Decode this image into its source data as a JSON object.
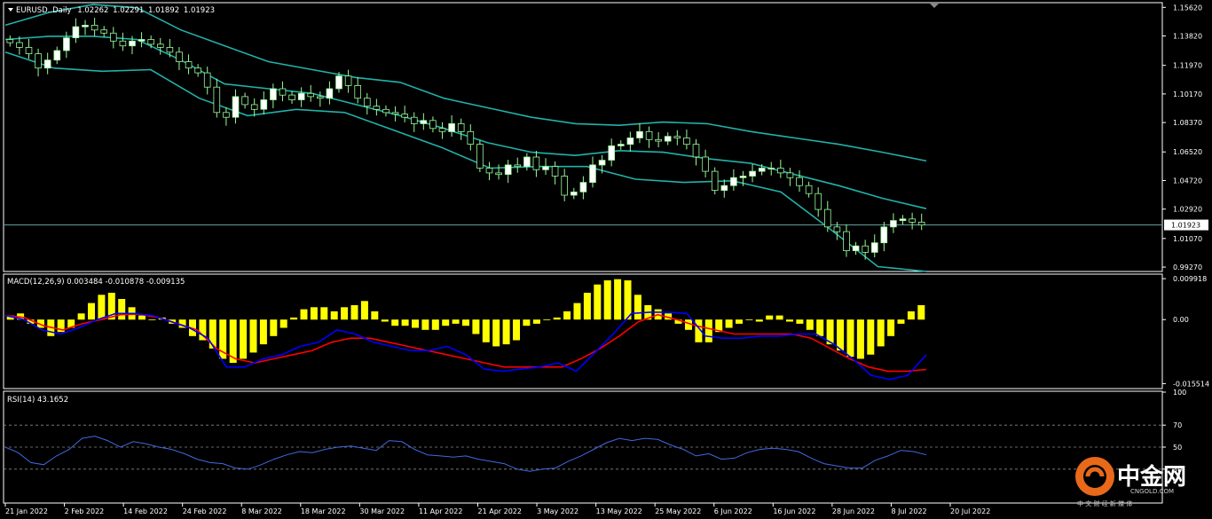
{
  "chart_data": [
    {
      "type": "candlestick",
      "panel": "price",
      "title": "EURUSD..Daily",
      "ohlc_header": [
        "1.02262",
        "1.02291",
        "1.01892",
        "1.01923"
      ],
      "current_price": 1.01923,
      "current_price_label": "1.01923",
      "ylim": [
        0.9905,
        1.1586
      ],
      "yticks": [
        1.1562,
        1.1382,
        1.1197,
        1.1017,
        1.0837,
        1.0652,
        1.0472,
        1.0292,
        1.0107,
        0.9927
      ],
      "ytick_labels": [
        "1.15620",
        "1.13820",
        "1.11970",
        "1.10170",
        "1.08370",
        "1.06520",
        "1.04720",
        "1.02920",
        "1.01070",
        "0.99270"
      ],
      "xlabels": [
        "21 Jan 2022",
        "2 Feb 2022",
        "14 Feb 2022",
        "24 Feb 2022",
        "8 Mar 2022",
        "18 Mar 2022",
        "30 Mar 2022",
        "11 Apr 2022",
        "21 Apr 2022",
        "3 May 2022",
        "13 May 2022",
        "25 May 2022",
        "6 Jun 2022",
        "16 Jun 2022",
        "28 Jun 2022",
        "8 Jul 2022",
        "20 Jul 2022"
      ],
      "close_series": [
        1.134,
        1.131,
        1.127,
        1.118,
        1.123,
        1.129,
        1.137,
        1.144,
        1.145,
        1.142,
        1.14,
        1.135,
        1.132,
        1.135,
        1.136,
        1.133,
        1.131,
        1.128,
        1.122,
        1.118,
        1.115,
        1.106,
        1.09,
        1.087,
        1.1,
        1.095,
        1.092,
        1.098,
        1.105,
        1.101,
        1.098,
        1.102,
        1.1,
        1.099,
        1.105,
        1.113,
        1.107,
        1.099,
        1.094,
        1.092,
        1.09,
        1.089,
        1.087,
        1.083,
        1.085,
        1.08,
        1.078,
        1.083,
        1.078,
        1.07,
        1.055,
        1.052,
        1.051,
        1.057,
        1.056,
        1.062,
        1.054,
        1.056,
        1.05,
        1.038,
        1.04,
        1.046,
        1.057,
        1.06,
        1.069,
        1.07,
        1.074,
        1.078,
        1.073,
        1.072,
        1.075,
        1.074,
        1.07,
        1.062,
        1.053,
        1.041,
        1.044,
        1.049,
        1.05,
        1.053,
        1.055,
        1.055,
        1.052,
        1.049,
        1.044,
        1.039,
        1.029,
        1.018,
        1.015,
        1.003,
        1.006,
        1.002,
        1.008,
        1.018,
        1.022,
        1.023,
        1.021,
        1.0192
      ],
      "bollinger": {
        "upper": [
          1.145,
          1.153,
          1.158,
          1.156,
          1.142,
          1.132,
          1.122,
          1.117,
          1.112,
          1.109,
          1.099,
          1.093,
          1.087,
          1.083,
          1.082,
          1.084,
          1.083,
          1.078,
          1.074,
          1.07,
          1.065,
          1.0595
        ],
        "middle": [
          1.136,
          1.138,
          1.138,
          1.136,
          1.123,
          1.108,
          1.105,
          1.102,
          1.095,
          1.088,
          1.08,
          1.071,
          1.065,
          1.063,
          1.066,
          1.065,
          1.061,
          1.058,
          1.051,
          1.044,
          1.036,
          1.0295
        ],
        "lower": [
          1.128,
          1.118,
          1.116,
          1.117,
          1.099,
          1.088,
          1.092,
          1.09,
          1.079,
          1.068,
          1.055,
          1.056,
          1.056,
          1.048,
          1.046,
          1.047,
          1.04,
          1.017,
          0.993,
          0.99
        ]
      }
    },
    {
      "type": "macd",
      "panel": "macd",
      "title": "MACD(12,26,9) 0.003484 -0.010878 -0.009135",
      "ylim": [
        -0.0165,
        0.0108
      ],
      "ytick_labels": [
        "0.009918",
        "0.00",
        "-0.015514"
      ],
      "yticks": [
        0.009918,
        0.0,
        -0.015514
      ],
      "histogram": [
        0.001,
        0.0015,
        -0.001,
        -0.002,
        -0.004,
        -0.003,
        -0.002,
        0.0015,
        0.004,
        0.006,
        0.0065,
        0.005,
        0.003,
        0.001,
        0.0,
        0.0005,
        -0.001,
        -0.002,
        -0.004,
        -0.005,
        -0.007,
        -0.0095,
        -0.0105,
        -0.0095,
        -0.008,
        -0.006,
        -0.004,
        -0.002,
        0.0005,
        0.0025,
        0.003,
        0.003,
        0.002,
        0.003,
        0.0035,
        0.0045,
        0.002,
        -0.0005,
        -0.0015,
        -0.0015,
        -0.002,
        -0.0025,
        -0.0025,
        -0.0015,
        -0.001,
        -0.0015,
        -0.0035,
        -0.0055,
        -0.0065,
        -0.006,
        -0.005,
        -0.0015,
        -0.001,
        0.0,
        0.0005,
        0.002,
        0.004,
        0.0065,
        0.0085,
        0.0095,
        0.0098,
        0.0095,
        0.006,
        0.0035,
        0.0025,
        0.0015,
        -0.001,
        -0.0025,
        -0.0055,
        -0.0055,
        -0.003,
        -0.002,
        -0.001,
        0.0,
        -0.0005,
        0.001,
        0.001,
        -0.0005,
        -0.001,
        -0.0025,
        -0.004,
        -0.006,
        -0.0075,
        -0.009,
        -0.0095,
        -0.0085,
        -0.0065,
        -0.004,
        -0.001,
        0.002,
        0.0035
      ],
      "macd_line": [
        0.001,
        0.0,
        -0.0025,
        -0.0035,
        -0.002,
        0.0,
        0.0015,
        0.0015,
        0.001,
        -0.0005,
        -0.002,
        -0.0045,
        -0.0115,
        -0.0115,
        -0.0095,
        -0.0085,
        -0.0065,
        -0.0055,
        -0.0025,
        -0.0035,
        -0.0055,
        -0.0065,
        -0.0075,
        -0.0075,
        -0.0065,
        -0.0085,
        -0.012,
        -0.0125,
        -0.012,
        -0.0115,
        -0.0105,
        -0.0125,
        -0.008,
        -0.0035,
        0.0015,
        0.0018,
        0.0018,
        0.0015,
        -0.004,
        -0.0045,
        -0.0045,
        -0.004,
        -0.004,
        -0.0035,
        -0.0035,
        -0.006,
        -0.0095,
        -0.0135,
        -0.0145,
        -0.0135,
        -0.0085
      ],
      "signal_line": [
        0.001,
        0.0005,
        -0.0015,
        -0.0025,
        -0.001,
        0.0,
        0.0012,
        0.0013,
        0.0005,
        -0.001,
        -0.0025,
        -0.007,
        -0.0095,
        -0.0105,
        -0.0095,
        -0.0085,
        -0.0075,
        -0.0055,
        -0.0045,
        -0.0045,
        -0.0055,
        -0.0065,
        -0.0075,
        -0.0085,
        -0.0095,
        -0.0105,
        -0.0115,
        -0.0115,
        -0.0115,
        -0.0115,
        -0.0095,
        -0.007,
        -0.004,
        -0.0005,
        0.0012,
        0.0,
        -0.0015,
        -0.0025,
        -0.0035,
        -0.0035,
        -0.0035,
        -0.0035,
        -0.0045,
        -0.007,
        -0.0095,
        -0.0115,
        -0.0125,
        -0.0125,
        -0.0121
      ],
      "colors": {
        "histogram": "#ffff00",
        "macd": "#0000ff",
        "signal": "#ff0000"
      }
    },
    {
      "type": "line",
      "panel": "rsi",
      "title": "RSI(14) 43.1652",
      "ylim": [
        0,
        100
      ],
      "yticks": [
        100,
        70,
        50,
        30
      ],
      "ytick_labels": [
        "100",
        "70",
        "50",
        "30"
      ],
      "levels": [
        70,
        50,
        30
      ],
      "values": [
        50,
        45,
        36,
        34,
        42,
        48,
        58,
        60,
        56,
        50,
        55,
        53,
        50,
        48,
        44,
        39,
        36,
        35,
        31,
        30,
        34,
        39,
        43,
        46,
        45,
        48,
        50,
        51,
        49,
        47,
        56,
        55,
        48,
        43,
        42,
        41,
        42,
        39,
        37,
        35,
        30,
        28,
        30,
        31,
        37,
        42,
        48,
        54,
        58,
        56,
        58,
        57,
        52,
        48,
        42,
        44,
        39,
        40,
        45,
        48,
        49,
        48,
        46,
        40,
        35,
        33,
        31,
        31,
        38,
        42,
        47,
        46,
        43
      ],
      "color": "#4169e1"
    }
  ],
  "watermark": {
    "title": "中金网",
    "subtitle": "CNGOLD.COM",
    "tagline": "中 文 财 经 新 媒 体"
  },
  "colors": {
    "background": "#000000",
    "border": "#ffffff",
    "bollinger": "#20b2aa",
    "candle_bull": "#ffffff",
    "candle_bear": "#000000",
    "candle_wick": "#98fb98",
    "price_line": "#5f9ea0"
  }
}
